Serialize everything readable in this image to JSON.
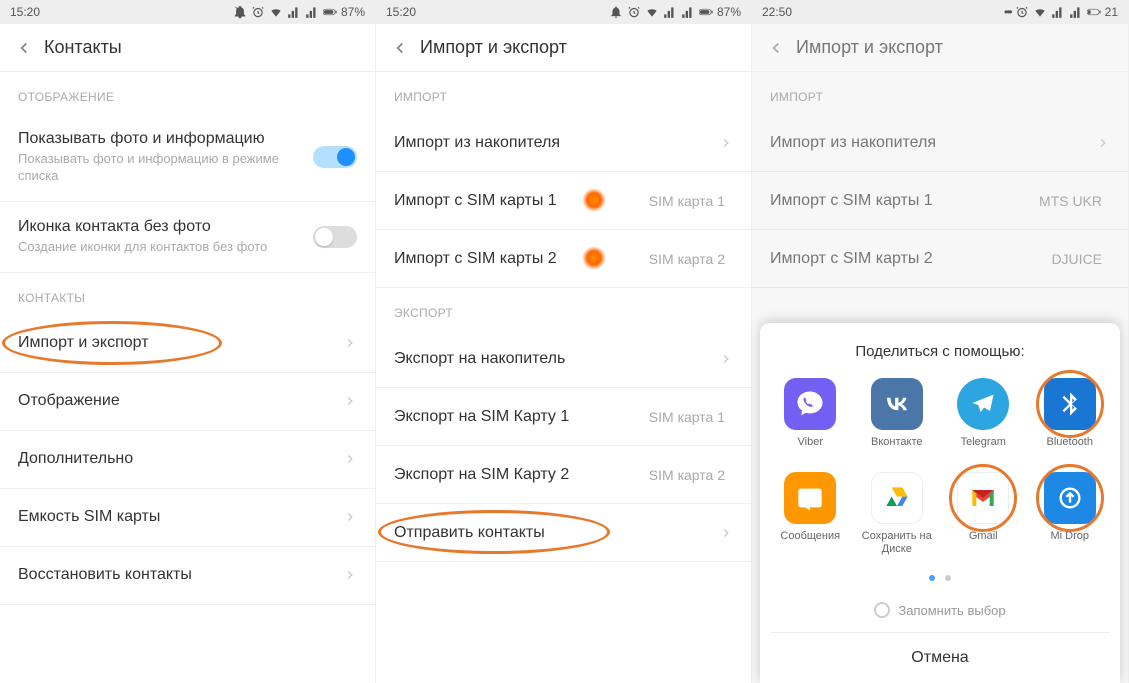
{
  "screen1": {
    "statusTime": "15:20",
    "battery": "87%",
    "headerTitle": "Контакты",
    "section1": "ОТОБРАЖЕНИЕ",
    "row1Title": "Показывать фото и информацию",
    "row1Sub": "Показывать фото и информацию в режиме списка",
    "row2Title": "Иконка контакта без фото",
    "row2Sub": "Создание иконки для контактов без фото",
    "section2": "КОНТАКТЫ",
    "row3": "Импорт и экспорт",
    "row4": "Отображение",
    "row5": "Дополнительно",
    "row6": "Емкость SIM карты",
    "row7": "Восстановить контакты"
  },
  "screen2": {
    "statusTime": "15:20",
    "battery": "87%",
    "headerTitle": "Импорт и экспорт",
    "section1": "ИМПОРТ",
    "row1": "Импорт из накопителя",
    "row2": "Импорт с SIM карты 1",
    "row2val": "SIM карта 1",
    "row3": "Импорт с SIM карты 2",
    "row3val": "SIM карта 2",
    "section2": "ЭКСПОРТ",
    "row4": "Экспорт на накопитель",
    "row5": "Экспорт на SIM Карту 1",
    "row5val": "SIM карта 1",
    "row6": "Экспорт на SIM Карту 2",
    "row6val": "SIM карта 2",
    "row7": "Отправить контакты"
  },
  "screen3": {
    "statusTime": "22:50",
    "battery": "21",
    "headerTitle": "Импорт и экспорт",
    "section1": "ИМПОРТ",
    "row1": "Импорт из накопителя",
    "row2": "Импорт с SIM карты 1",
    "row2val": "MTS UKR",
    "row3": "Импорт с SIM карты 2",
    "row3val": "DJUICE",
    "shareTitle": "Поделиться с помощью:",
    "apps": {
      "viber": "Viber",
      "vk": "Вконтакте",
      "telegram": "Telegram",
      "bluetooth": "Bluetooth",
      "messages": "Сообщения",
      "drive": "Сохранить на Диске",
      "gmail": "Gmail",
      "midrop": "Mi Drop"
    },
    "remember": "Запомнить выбор",
    "cancel": "Отмена"
  }
}
